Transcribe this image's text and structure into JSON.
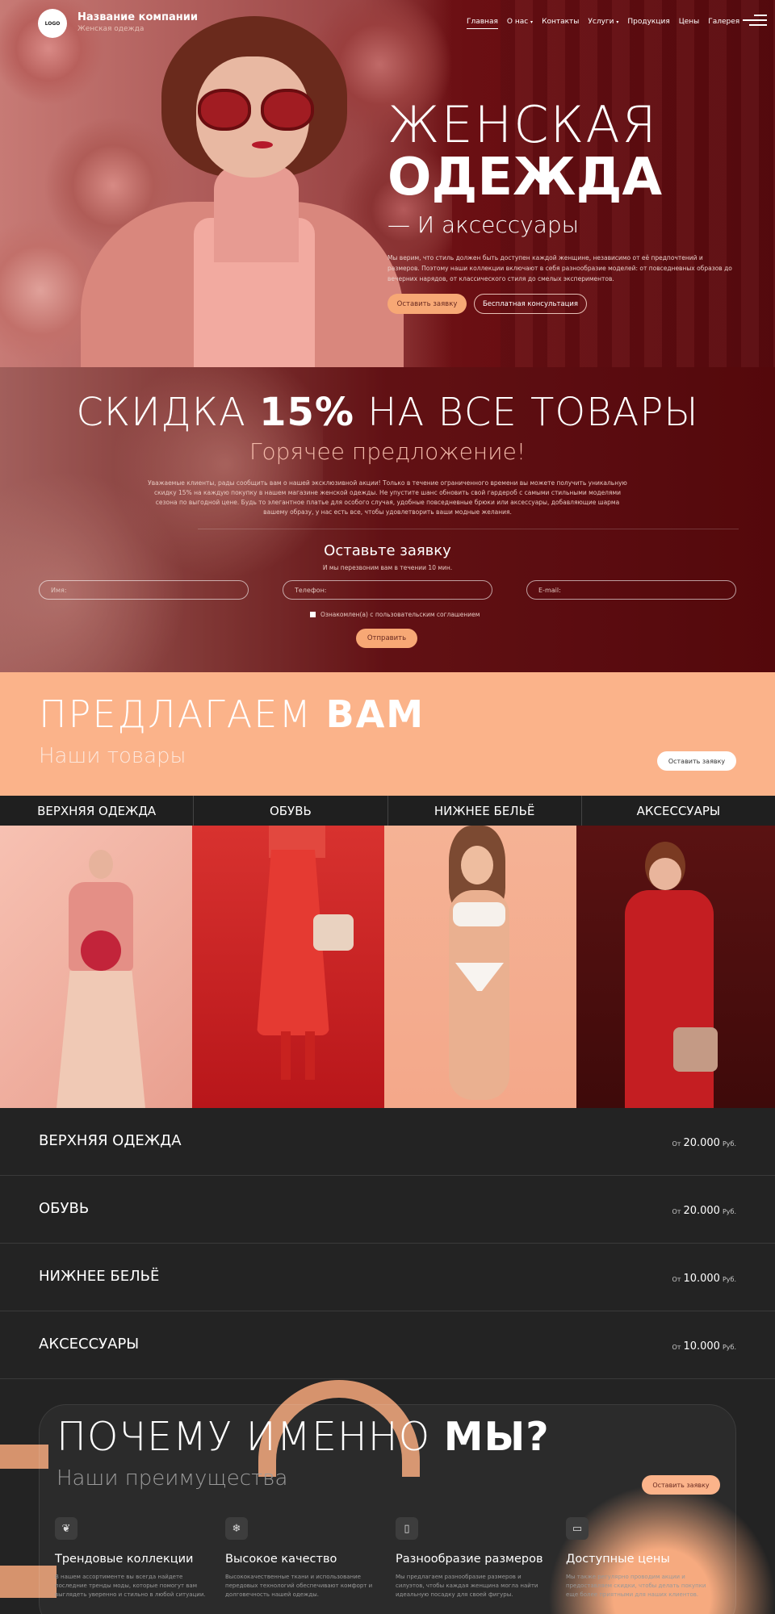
{
  "header": {
    "logo": "LOGO",
    "company": "Название компании",
    "tagline": "Женская одежда",
    "nav": [
      "Главная",
      "О нас",
      "Контакты",
      "Услуги",
      "Продукция",
      "Цены",
      "Галерея"
    ]
  },
  "hero": {
    "title1": "ЖЕНСКАЯ",
    "title2": "ОДЕЖДА",
    "title3": "— И аксессуары",
    "text": "Мы верим, что стиль должен быть доступен каждой женщине, независимо от её предпочтений и размеров. Поэтому наши коллекции включают в себя разнообразие моделей: от повседневных образов до вечерних нарядов, от классического стиля до смелых экспериментов.",
    "btn_primary": "Оставить заявку",
    "btn_secondary": "Бесплатная консультация"
  },
  "promo": {
    "title_pre": "СКИДКА ",
    "title_bold": "15%",
    "title_post": " НА ВСЕ ТОВАРЫ",
    "subtitle": "Горячее предложение!",
    "text": "Уважаемые клиенты, рады сообщить вам о нашей эксклюзивной акции! Только в течение ограниченного времени вы можете получить уникальную скидку 15% на каждую покупку в нашем магазине женской одежды. Не упустите шанс обновить свой гардероб с самыми стильными моделями сезона по выгодной цене. Будь то элегантное платье для особого случая, удобные повседневные брюки или аксессуары, добавляющие шарма вашему образу, у нас есть все, чтобы удовлетворить ваши модные желания.",
    "form_title": "Оставьте заявку",
    "form_sub": "И мы перезвоним вам в течении 10 мин.",
    "name_ph": "Имя:",
    "phone_ph": "Телефон:",
    "email_ph": "E-mail:",
    "agree": "Ознакомлен(а) с пользовательским соглашением",
    "send": "Отправить"
  },
  "offer": {
    "title_pre": "ПРЕДЛАГАЕМ ",
    "title_bold": "ВАМ",
    "subtitle": "Наши товары",
    "btn": "Оставить заявку"
  },
  "categories": [
    "ВЕРХНЯЯ ОДЕЖДА",
    "ОБУВЬ",
    "НИЖНЕЕ БЕЛЬЁ",
    "АКСЕССУАРЫ"
  ],
  "prices": [
    {
      "name": "ВЕРХНЯЯ ОДЕЖДА",
      "from": "От",
      "value": "20.000",
      "cur": "Руб."
    },
    {
      "name": "ОБУВЬ",
      "from": "От",
      "value": "20.000",
      "cur": "Руб."
    },
    {
      "name": "НИЖНЕЕ БЕЛЬЁ",
      "from": "От",
      "value": "10.000",
      "cur": "Руб."
    },
    {
      "name": "АКСЕССУАРЫ",
      "from": "От",
      "value": "10.000",
      "cur": "Руб."
    }
  ],
  "why": {
    "title_pre": "ПОЧЕМУ ИМЕННО ",
    "title_bold": "МЫ?",
    "subtitle": "Наши преимущества",
    "btn": "Оставить заявку",
    "features": [
      {
        "icon": "trend-icon",
        "title": "Трендовые коллекции",
        "text": "В нашем ассортименте вы всегда найдете последние тренды моды, которые помогут вам выглядеть уверенно и стильно в любой ситуации."
      },
      {
        "icon": "quality-icon",
        "title": "Высокое качество",
        "text": "Высококачественные ткани и использование передовых технологий обеспечивают комфорт и долговечность нашей одежды."
      },
      {
        "icon": "size-icon",
        "title": "Разнообразие размеров",
        "text": "Мы предлагаем разнообразие размеров и силуэтов, чтобы каждая женщина могла найти идеальную посадку для своей фигуры."
      },
      {
        "icon": "price-icon",
        "title": "Доступные цены",
        "text": "Мы также регулярно проводим акции и предоставляем скидки, чтобы делать покупки еще более приятными для наших клиентов."
      }
    ]
  },
  "colors": {
    "accent": "#fbb38a",
    "dark": "#232323",
    "wine": "#6b0f13"
  }
}
